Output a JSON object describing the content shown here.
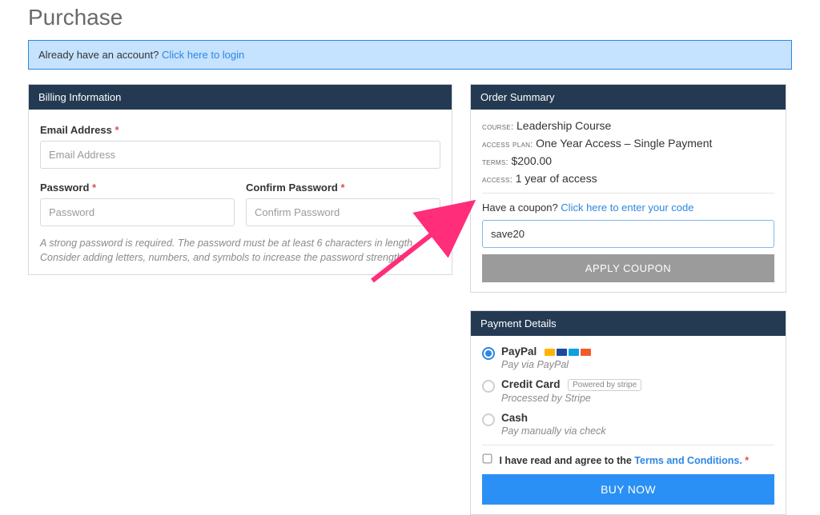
{
  "page_title": "Purchase",
  "notice": {
    "prefix": "Already have an account? ",
    "link": "Click here to login"
  },
  "billing": {
    "header": "Billing Information",
    "email_label": "Email Address",
    "email_placeholder": "Email Address",
    "password_label": "Password",
    "password_placeholder": "Password",
    "confirm_label": "Confirm Password",
    "confirm_placeholder": "Confirm Password",
    "hint": "A strong password is required. The password must be at least 6 characters in length. Consider adding letters, numbers, and symbols to increase the password strength."
  },
  "order": {
    "header": "Order Summary",
    "lines": {
      "course_key": "COURSE:",
      "course_val": "Leadership Course",
      "plan_key": "ACCESS PLAN:",
      "plan_val": "One Year Access – Single Payment",
      "terms_key": "TERMS:",
      "terms_val": "$200.00",
      "access_key": "ACCESS:",
      "access_val": "1 year of access"
    },
    "coupon_prefix": "Have a coupon? ",
    "coupon_link": "Click here to enter your code",
    "coupon_value": "save20",
    "apply_label": "APPLY COUPON"
  },
  "payment": {
    "header": "Payment Details",
    "options": [
      {
        "title": "PayPal",
        "subtitle": "Pay via PayPal",
        "selected": true,
        "decor": "cards"
      },
      {
        "title": "Credit Card",
        "subtitle": "Processed by Stripe",
        "selected": false,
        "decor": "stripe_badge",
        "badge_text": "Powered by stripe"
      },
      {
        "title": "Cash",
        "subtitle": "Pay manually via check",
        "selected": false,
        "decor": "none"
      }
    ],
    "agree_prefix": "I have read and agree to the ",
    "agree_link": "Terms and Conditions.",
    "buy_label": "BUY NOW"
  }
}
